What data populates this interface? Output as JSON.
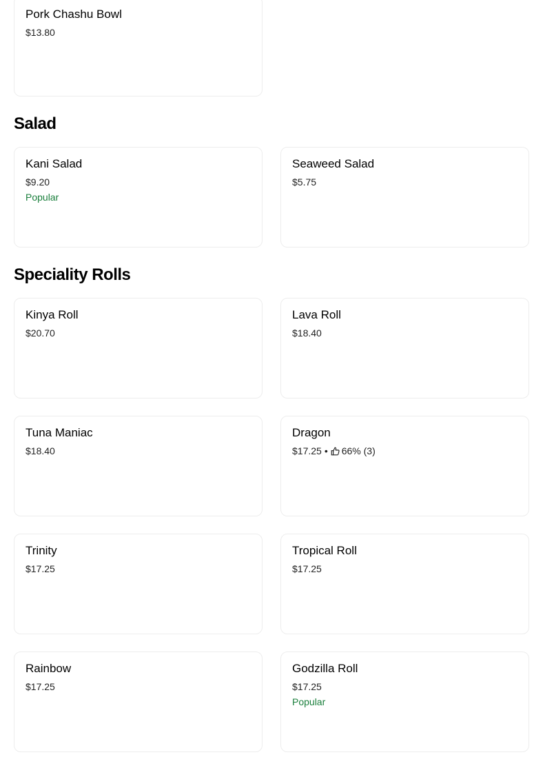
{
  "colors": {
    "popular": "#1a7f3c",
    "card_border": "#ededed"
  },
  "top_item": {
    "name": "Pork Chashu Bowl",
    "price": "$13.80"
  },
  "sections": {
    "salad": {
      "title": "Salad",
      "items": [
        {
          "name": "Kani Salad",
          "price": "$9.20",
          "badge": "Popular"
        },
        {
          "name": "Seaweed Salad",
          "price": "$5.75"
        }
      ]
    },
    "speciality_rolls": {
      "title": "Speciality Rolls",
      "items": [
        {
          "name": "Kinya Roll",
          "price": "$20.70"
        },
        {
          "name": "Lava Roll",
          "price": "$18.40"
        },
        {
          "name": "Tuna Maniac",
          "price": "$18.40"
        },
        {
          "name": "Dragon",
          "price": "$17.25",
          "separator": "•",
          "rating_icon": "thumbs-up-icon",
          "rating": "66% (3)"
        },
        {
          "name": "Trinity",
          "price": "$17.25"
        },
        {
          "name": "Tropical Roll",
          "price": "$17.25"
        },
        {
          "name": "Rainbow",
          "price": "$17.25"
        },
        {
          "name": "Godzilla Roll",
          "price": "$17.25",
          "badge": "Popular"
        }
      ]
    }
  }
}
